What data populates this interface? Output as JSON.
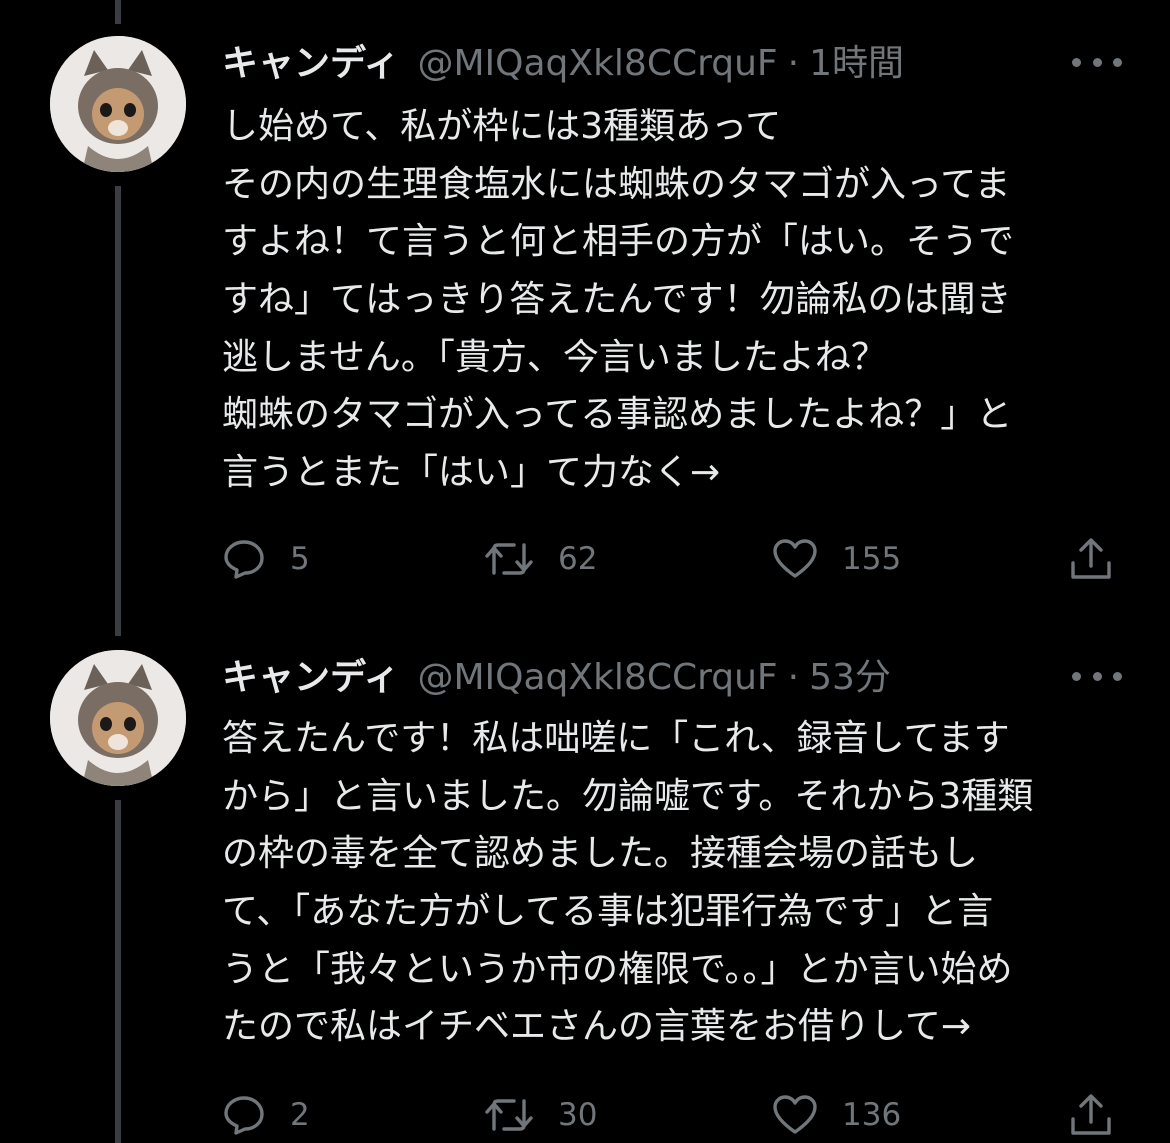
{
  "tweets": [
    {
      "name": "キャンディ",
      "handle": "@MIQaqXkl8CCrquF",
      "separator": "·",
      "time": "1時間",
      "lines": [
        "し始めて、私が枠には3種類あって",
        "その内の生理食塩水には蜘蛛のタマゴが入ってま",
        "すよね！て言うと何と相手の方が「はい。そうで",
        "すね」てはっきり答えたんです！勿論私のは聞き",
        "逃しません。「貴方、今言いましたよね？",
        "蜘蛛のタマゴが入ってる事認めましたよね？」と",
        "言うとまた「はい」て力なく→"
      ],
      "replies": "5",
      "retweets": "62",
      "likes": "155"
    },
    {
      "name": "キャンディ",
      "handle": "@MIQaqXkl8CCrquF",
      "separator": "·",
      "time": "53分",
      "lines": [
        "答えたんです！私は咄嗟に「これ、録音してます",
        "から」と言いました。勿論嘘です。それから3種類",
        "の枠の毒を全て認めました。接種会場の話もし",
        "て、「あなた方がしてる事は犯罪行為です」と言",
        "うと「我々というか市の権限で。。」とか言い始め",
        "たので私はイチベエさんの言葉をお借りして→"
      ],
      "replies": "2",
      "retweets": "30",
      "likes": "136"
    }
  ],
  "icons": {
    "reply": "reply-icon",
    "retweet": "retweet-icon",
    "like": "heart-icon",
    "share": "share-icon",
    "more": "more-options-icon"
  },
  "colors": {
    "background": "#000000",
    "text": "#e7e9ea",
    "muted": "#71767b",
    "thread_line": "#3a3d42"
  }
}
